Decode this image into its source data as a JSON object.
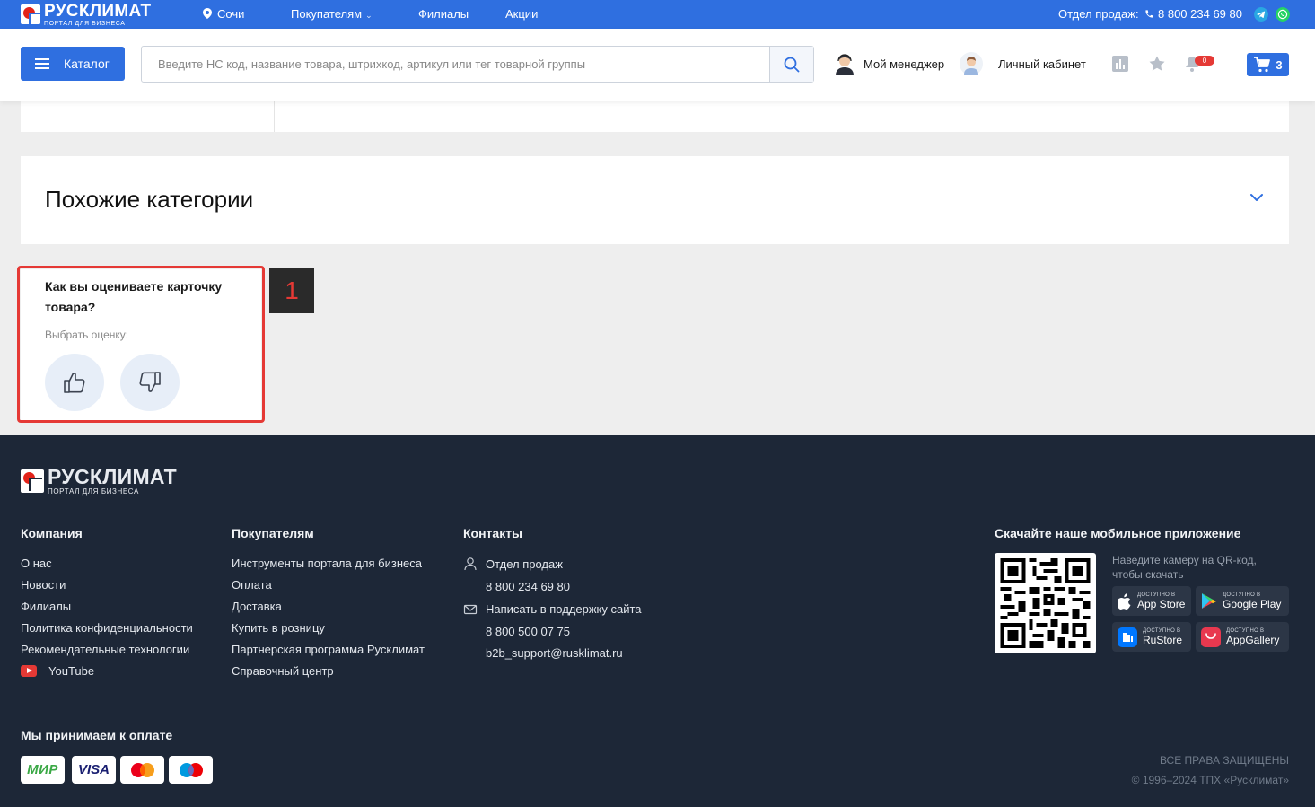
{
  "topbar": {
    "logo_title": "РУСКЛИМАТ",
    "logo_subtitle": "ПОРТАЛ ДЛЯ БИЗНЕСА",
    "city": "Сочи",
    "nav": [
      "Покупателям",
      "Филиалы",
      "Акции"
    ],
    "sales_label": "Отдел продаж:",
    "sales_phone": "8 800 234 69 80"
  },
  "header": {
    "catalog_label": "Каталог",
    "search_placeholder": "Введите НС код, название товара, штрихкод, артикул или тег товарной группы",
    "manager_label": "Мой менеджер",
    "account_label": "Личный кабинет",
    "notifications_count": "0",
    "cart_count": "3"
  },
  "similar": {
    "title": "Похожие категории"
  },
  "rating": {
    "question": "Как вы оцениваете карточку товара?",
    "hint": "Выбрать оценку:",
    "marker": "1"
  },
  "footer": {
    "logo_title": "РУСКЛИМАТ",
    "logo_subtitle": "ПОРТАЛ ДЛЯ БИЗНЕСА",
    "company_head": "Компания",
    "company_items": [
      "О нас",
      "Новости",
      "Филиалы",
      "Политика конфиденциальности",
      "Рекомендательные технологии",
      "YouTube"
    ],
    "buyers_head": "Покупателям",
    "buyers_items": [
      "Инструменты портала для бизнеса",
      "Оплата",
      "Доставка",
      "Купить в розницу",
      "Партнерская программа Русклимат",
      "Справочный центр"
    ],
    "contacts_head": "Контакты",
    "sales_dept": "Отдел продаж",
    "sales_phone": "8 800 234 69 80",
    "support_label": "Написать в поддержку сайта",
    "support_phone": "8 800 500 07 75",
    "support_email": "b2b_support@rusklimat.ru",
    "app_head": "Скачайте наше мобильное приложение",
    "app_hint": "Наведите камеру на QR-код, чтобы скачать",
    "stores": [
      {
        "small": "ДОСТУПНО В",
        "big": "App Store"
      },
      {
        "small": "ДОСТУПНО В",
        "big": "Google Play"
      },
      {
        "small": "ДОСТУПНО В",
        "big": "RuStore"
      },
      {
        "small": "ДОСТУПНО В",
        "big": "AppGallery"
      }
    ],
    "payment_head": "Мы принимаем к оплате",
    "payments": [
      "МИР",
      "VISA"
    ],
    "rights": "ВСЕ ПРАВА ЗАЩИЩЕНЫ",
    "copyright": "© 1996–2024 ТПХ «Русклимат»"
  },
  "colors": {
    "brand_blue": "#2f6fe0",
    "footer_bg": "#1d2737",
    "highlight_red": "#e53935"
  }
}
